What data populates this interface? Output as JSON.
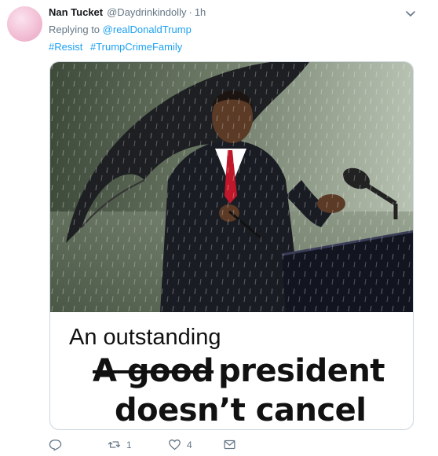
{
  "tweet": {
    "display_name": "Nan Tucket",
    "handle": "@Daydrinkindolly",
    "separator": "·",
    "time": "1h",
    "reply_prefix": "Replying to",
    "reply_to": "@realDonaldTrump",
    "hashtags": [
      "#Resist",
      "#TrumpCrimeFamily"
    ]
  },
  "media": {
    "caption_line1": "An outstanding",
    "caption_struck": "A good",
    "caption_line2_rest": "president",
    "caption_line3": "doesn’t cancel"
  },
  "actions": {
    "reply_count": "",
    "retweet_count": "1",
    "like_count": "4"
  },
  "icons": {
    "more": "chevron-down-icon",
    "reply": "reply-icon",
    "retweet": "retweet-icon",
    "like": "heart-icon",
    "dm": "envelope-icon"
  }
}
